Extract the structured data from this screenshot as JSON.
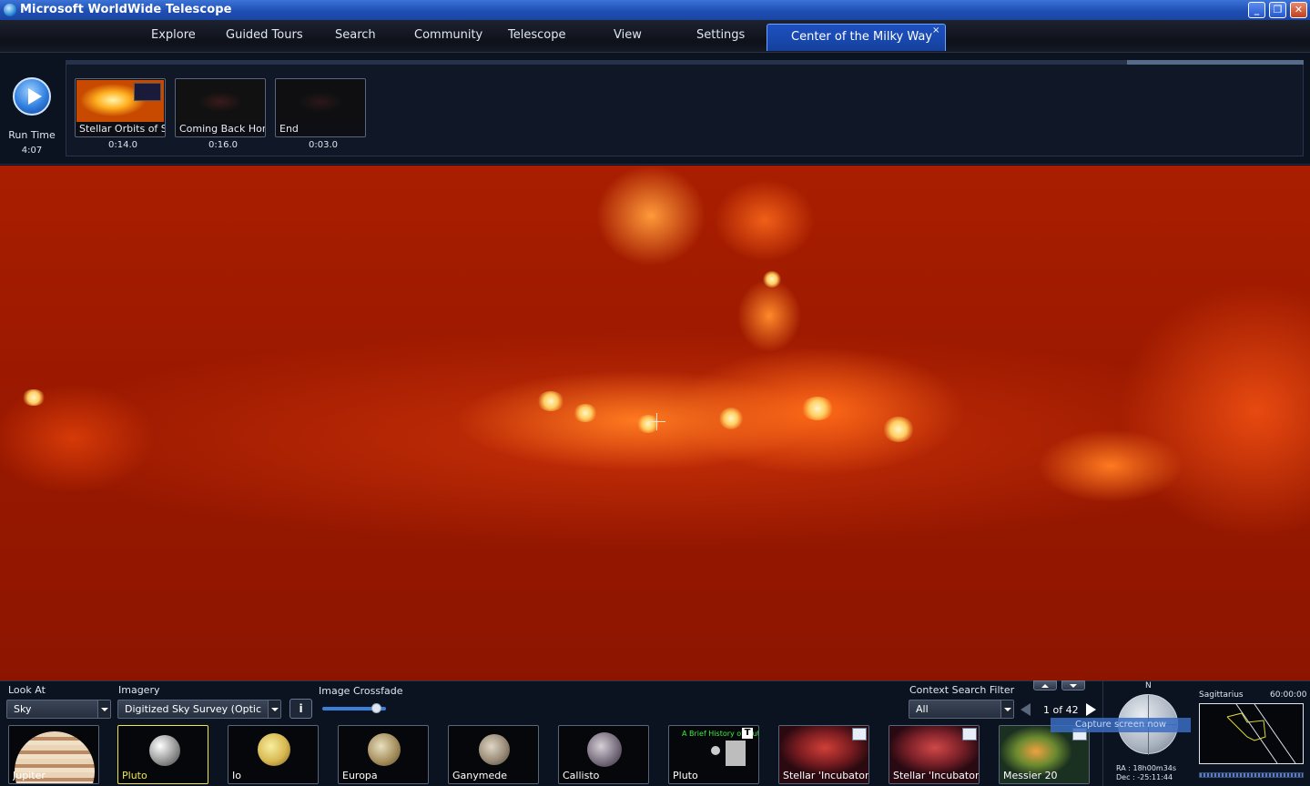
{
  "window": {
    "title": "Microsoft WorldWide Telescope"
  },
  "menu": {
    "items": [
      "Explore",
      "Guided Tours",
      "Search",
      "Community",
      "Telescope",
      "View",
      "Settings"
    ],
    "active_tour_tab": "Center of the Milky Way",
    "close_glyph": "×"
  },
  "tour": {
    "run_time_label": "Run Time",
    "run_time_value": "4:07",
    "slides": [
      {
        "caption": "Stellar Orbits of S...",
        "time": "0:14.0"
      },
      {
        "caption": "Coming Back Home",
        "time": "0:16.0"
      },
      {
        "caption": "End",
        "time": "0:03.0"
      }
    ]
  },
  "controls": {
    "look_at_label": "Look At",
    "look_at_value": "Sky",
    "imagery_label": "Imagery",
    "imagery_value": "Digitized Sky Survey (Optical...",
    "crossfade_label": "Image Crossfade",
    "crossfade_level": 0.85,
    "context_filter_label": "Context Search Filter",
    "context_filter_value": "All",
    "page_indicator": "1 of 42"
  },
  "thumbnails": [
    {
      "label": "Jupiter",
      "selected": false
    },
    {
      "label": "Pluto",
      "selected": true
    },
    {
      "label": "Io",
      "selected": false
    },
    {
      "label": "Europa",
      "selected": false
    },
    {
      "label": "Ganymede",
      "selected": false
    },
    {
      "label": "Callisto",
      "selected": false
    },
    {
      "label": "Pluto",
      "selected": false,
      "banner": "A Brief History of Pluto"
    },
    {
      "label": "Stellar 'Incubator...",
      "selected": false
    },
    {
      "label": "Stellar 'Incubator...",
      "selected": false
    },
    {
      "label": "Messier 20",
      "selected": false
    }
  ],
  "navigation": {
    "north_label": "N",
    "tooltip": "Capture screen now",
    "ra_text": "RA :  18h00m34s",
    "dec_text": "Dec : -25:11:44",
    "constellation": "Sagittarius",
    "field_of_view": "60:00:00"
  },
  "colors": {
    "accent": "#1e4fc0",
    "sky_base": "#a91e00",
    "selection": "#f0e64a"
  }
}
